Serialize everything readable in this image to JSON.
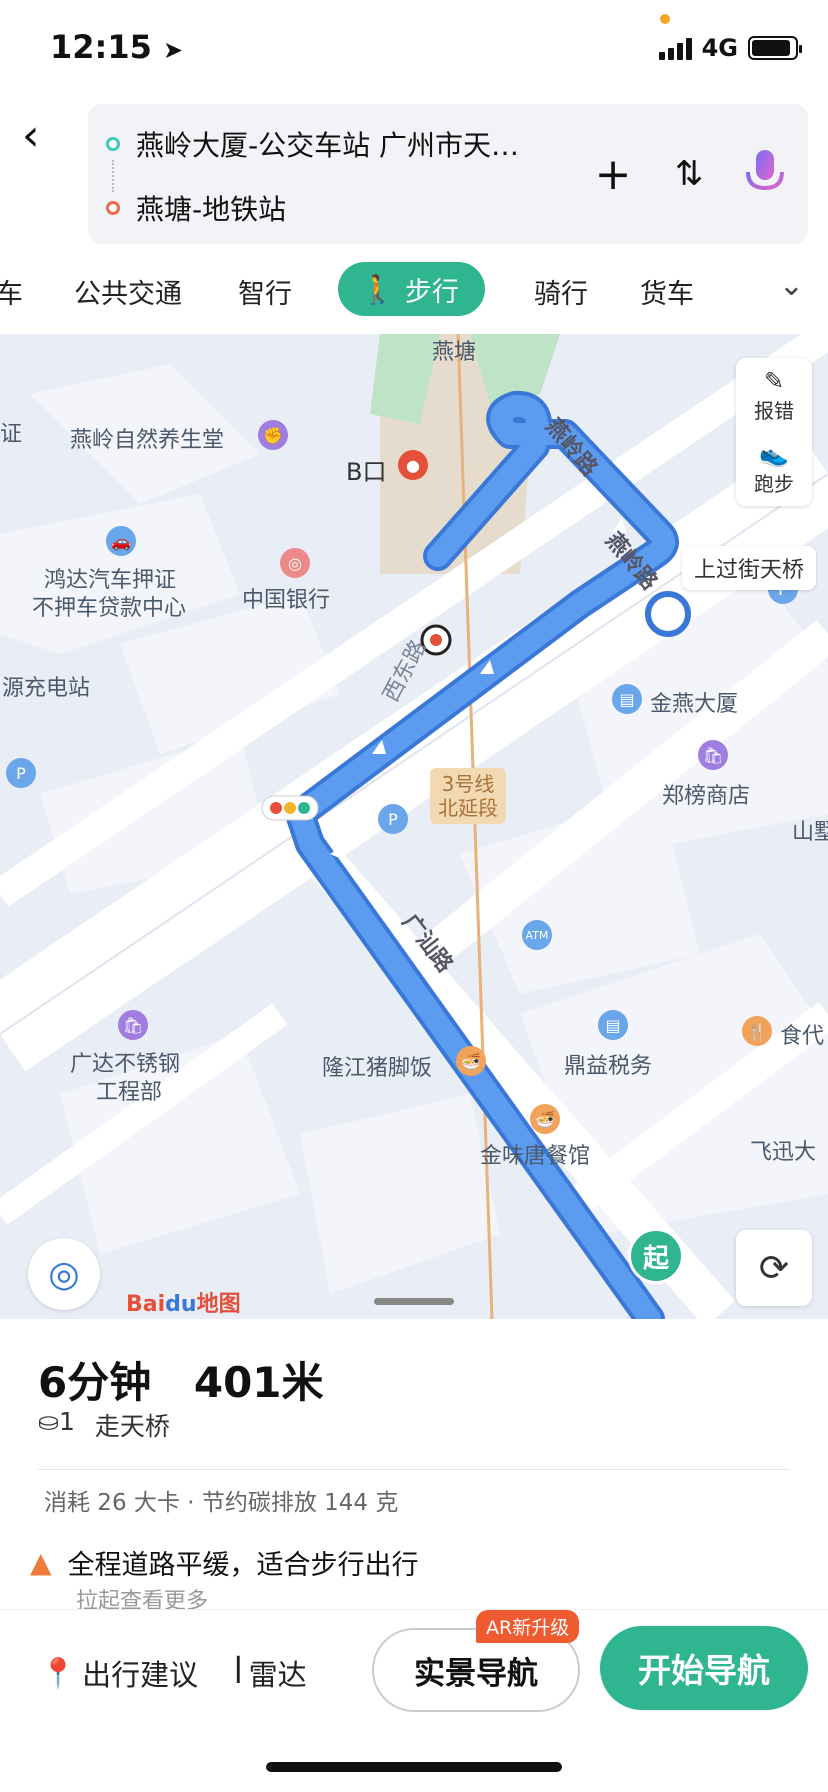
{
  "status": {
    "time": "12:15",
    "network": "4G",
    "battery_level": 0.9
  },
  "route": {
    "from": "燕岭大厦-公交车站 广州市天…",
    "to": "燕塘-地铁站",
    "back_icon": "chevron-left-icon",
    "add_icon": "plus-icon",
    "swap_icon": "swap-icon",
    "voice_icon": "microphone-icon"
  },
  "tabs": {
    "items": [
      "车",
      "公共交通",
      "智行",
      "步行",
      "骑行",
      "货车"
    ],
    "active": "步行",
    "more_icon": "chevron-down-icon"
  },
  "map": {
    "pois": {
      "yantang": "燕塘",
      "nature_hall": "燕岭自然养生堂",
      "b_exit": "B口",
      "hongda_line1": "鸿达汽车押证",
      "hongda_line2": "不押车贷款中心",
      "boc": "中国银行",
      "charging": "源充电站",
      "jinyan": "金燕大厦",
      "zhengbang": "郑榜商店",
      "shan": "山墅",
      "metro_line1": "3号线",
      "metro_line2": "北延段",
      "guangda_line1": "广达不锈钢",
      "guangda_line2": "工程部",
      "longjiang": "隆江猪脚饭",
      "dingyi": "鼎益税务",
      "shidai": "食代",
      "jinwei": "金味唐餐馆",
      "xunda": "飞迅大",
      "edge_zheng": "证",
      "atm": "ATM"
    },
    "roads": {
      "yanling_1": "燕岭路",
      "yanling_2": "燕岭路",
      "guangshan": "广汕路",
      "xitong": "西东路"
    },
    "buttons": {
      "report": "报错",
      "run": "跑步"
    },
    "bubble": "上过街天桥",
    "start_marker": "起",
    "logo": "Bai地图"
  },
  "summary": {
    "time": "6分钟",
    "distance": "401米",
    "crossings": "1",
    "bridge": "走天桥",
    "stats": "消耗 26 大卡 · 节约碳排放 144 克",
    "tip": "全程道路平缓，适合步行出行",
    "tip_sub": "拉起查看更多"
  },
  "actions": {
    "advice": "出行建议",
    "radar": "雷达",
    "ar_nav": "实景导航",
    "ar_badge": "AR新升级",
    "start_nav": "开始导航"
  },
  "colors": {
    "accent": "#2fb58f",
    "route": "#4f8ee8",
    "badge": "#ef5b2f"
  }
}
